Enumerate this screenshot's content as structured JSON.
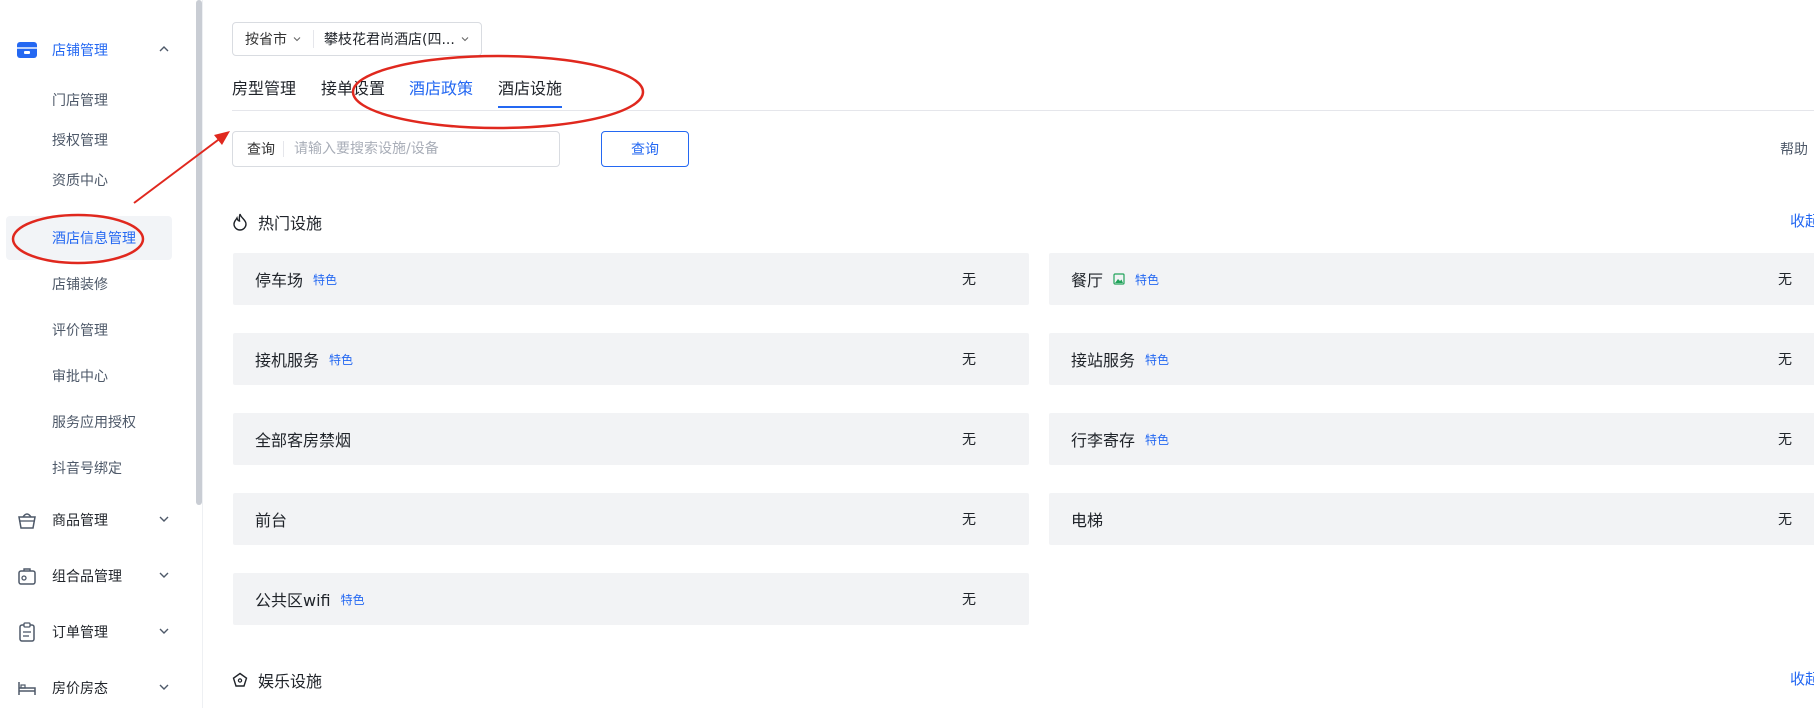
{
  "sidebar": {
    "store_group": {
      "label": "店铺管理",
      "icon": "store-icon",
      "expanded": true
    },
    "store_items": [
      {
        "label": "门店管理"
      },
      {
        "label": "授权管理"
      },
      {
        "label": "资质中心"
      },
      {
        "label": "酒店信息管理",
        "selected": true
      },
      {
        "label": "店铺装修"
      },
      {
        "label": "评价管理"
      },
      {
        "label": "审批中心"
      },
      {
        "label": "服务应用授权"
      },
      {
        "label": "抖音号绑定"
      }
    ],
    "groups": [
      {
        "label": "商品管理",
        "icon": "basket-icon"
      },
      {
        "label": "组合品管理",
        "icon": "combo-bag-icon"
      },
      {
        "label": "订单管理",
        "icon": "clipboard-icon"
      },
      {
        "label": "房价房态",
        "icon": "bed-icon"
      }
    ]
  },
  "filters": {
    "province_label": "按省市",
    "hotel_label": "攀枝花君尚酒店(四..."
  },
  "tabs": [
    {
      "label": "房型管理"
    },
    {
      "label": "接单设置"
    },
    {
      "label": "酒店政策"
    },
    {
      "label": "酒店设施",
      "active": true
    }
  ],
  "search": {
    "prefix": "查询",
    "placeholder": "请输入要搜索设施/设备",
    "button_label": "查询",
    "help_label": "帮助"
  },
  "sections": {
    "hot": {
      "title": "热门设施",
      "collapse_label": "收起",
      "icon": "flame-icon"
    },
    "entertainment": {
      "title": "娱乐设施",
      "collapse_label": "收起",
      "icon": "pentagon-icon"
    }
  },
  "facilities": [
    {
      "name": "停车场",
      "tag": "特色",
      "value": "无",
      "has_image": false
    },
    {
      "name": "餐厅",
      "tag": "特色",
      "value": "无",
      "has_image": true
    },
    {
      "name": "接机服务",
      "tag": "特色",
      "value": "无",
      "has_image": false
    },
    {
      "name": "接站服务",
      "tag": "特色",
      "value": "无",
      "has_image": false
    },
    {
      "name": "全部客房禁烟",
      "tag": "",
      "value": "无",
      "has_image": false
    },
    {
      "name": "行李寄存",
      "tag": "特色",
      "value": "无",
      "has_image": false
    },
    {
      "name": "前台",
      "tag": "",
      "value": "无",
      "has_image": false
    },
    {
      "name": "电梯",
      "tag": "",
      "value": "无",
      "has_image": false
    },
    {
      "name": "公共区wifi",
      "tag": "特色",
      "value": "无",
      "has_image": false
    }
  ],
  "colors": {
    "accent": "#2468f2",
    "annotation_red": "#e0281e",
    "card_bg": "#f2f3f5"
  }
}
